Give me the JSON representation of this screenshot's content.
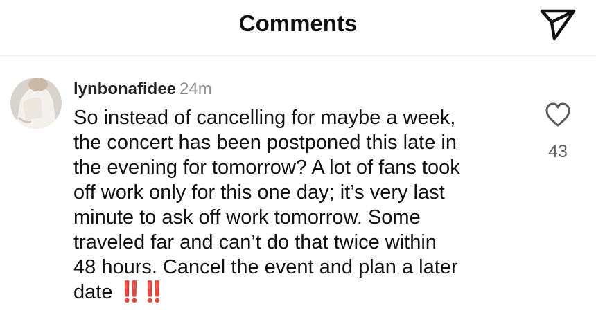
{
  "header": {
    "title": "Comments",
    "share_icon": "send-paper-plane-icon"
  },
  "comment": {
    "username": "lynbonafidee",
    "timestamp": "24m",
    "lines": [
      "So instead of cancelling for maybe a week,",
      "the concert has been postponed this late in",
      "the evening for tomorrow? A lot of fans took",
      "off work only for this one day; it’s very last",
      "minute to ask off work tomorrow. Some",
      "traveled far and can’t do that twice within",
      "48 hours. Cancel the event and plan a later",
      "date"
    ],
    "emoji": "‼️‼️",
    "likes": "43",
    "like_icon": "heart-outline-icon"
  },
  "colors": {
    "text": "#111111",
    "secondary": "#8e8e8e",
    "emoji_red": "#e0231c"
  }
}
